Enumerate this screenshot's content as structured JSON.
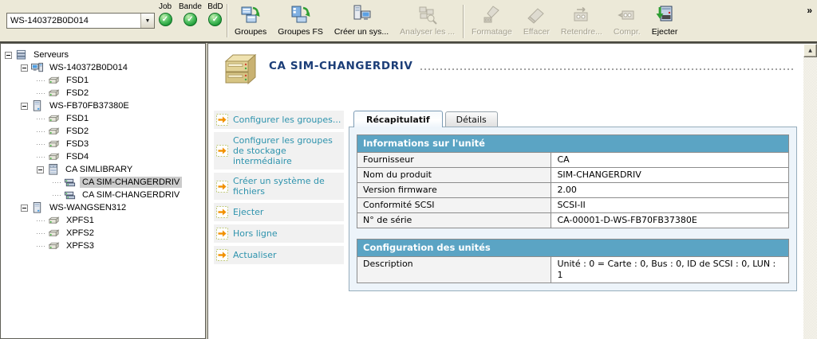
{
  "toolbar": {
    "server_selector": {
      "value": "WS-140372B0D014"
    },
    "status_indicators": [
      {
        "label": "Job",
        "state": "ok"
      },
      {
        "label": "Bande",
        "state": "ok"
      },
      {
        "label": "BdD",
        "state": "ok"
      }
    ],
    "buttons": [
      {
        "label": "Groupes",
        "icon": "groups-icon",
        "enabled": true
      },
      {
        "label": "Groupes FS",
        "icon": "groups-fs-icon",
        "enabled": true
      },
      {
        "label": "Créer un sys...",
        "icon": "create-fs-icon",
        "enabled": true
      },
      {
        "label": "Analyser les ...",
        "icon": "analyze-icon",
        "enabled": false
      },
      {
        "label": "Formatage",
        "icon": "format-icon",
        "enabled": false,
        "group_start": true
      },
      {
        "label": "Effacer",
        "icon": "erase-icon",
        "enabled": false
      },
      {
        "label": "Retendre...",
        "icon": "retension-icon",
        "enabled": false
      },
      {
        "label": "Compr.",
        "icon": "compress-icon",
        "enabled": false
      },
      {
        "label": "Ejecter",
        "icon": "eject-icon",
        "enabled": true
      }
    ],
    "overflow_chevron": "»"
  },
  "tree": {
    "items": [
      {
        "label": "Serveurs",
        "level": 0,
        "icon": "servers-icon",
        "expandable": true
      },
      {
        "label": "WS-140372B0D014",
        "level": 1,
        "icon": "computer-icon",
        "expandable": true
      },
      {
        "label": "FSD1",
        "level": 2,
        "icon": "drive-icon"
      },
      {
        "label": "FSD2",
        "level": 2,
        "icon": "drive-icon"
      },
      {
        "label": "WS-FB70FB37380E",
        "level": 1,
        "icon": "server-icon",
        "expandable": true
      },
      {
        "label": "FSD1",
        "level": 2,
        "icon": "drive-icon"
      },
      {
        "label": "FSD2",
        "level": 2,
        "icon": "drive-icon"
      },
      {
        "label": "FSD3",
        "level": 2,
        "icon": "drive-icon"
      },
      {
        "label": "FSD4",
        "level": 2,
        "icon": "drive-icon"
      },
      {
        "label": "CA SIMLIBRARY",
        "level": 2,
        "icon": "library-icon",
        "expandable": true
      },
      {
        "label": "CA SIM-CHANGERDRIV",
        "level": 3,
        "icon": "changer-icon",
        "selected": true
      },
      {
        "label": "CA SIM-CHANGERDRIV",
        "level": 3,
        "icon": "changer-icon"
      },
      {
        "label": "WS-WANGSEN312",
        "level": 1,
        "icon": "server-icon",
        "expandable": true
      },
      {
        "label": "XPFS1",
        "level": 2,
        "icon": "drive-icon"
      },
      {
        "label": "XPFS2",
        "level": 2,
        "icon": "drive-icon"
      },
      {
        "label": "XPFS3",
        "level": 2,
        "icon": "drive-icon"
      }
    ]
  },
  "main": {
    "title": "CA SIM-CHANGERDRIV",
    "device_icon": "tape-drive-icon",
    "actions": [
      "Configurer les groupes...",
      "Configurer les groupes de stockage intermédiaire",
      "Créer un système de fichiers",
      "Ejecter",
      "Hors ligne",
      "Actualiser"
    ],
    "tabs": [
      {
        "label": "Récapitulatif",
        "active": true
      },
      {
        "label": "Détails",
        "active": false
      }
    ],
    "sections": [
      {
        "header": "Informations sur l'unité",
        "rows": [
          {
            "label": "Fournisseur",
            "value": "CA"
          },
          {
            "label": "Nom du produit",
            "value": "SIM-CHANGERDRIV"
          },
          {
            "label": "Version firmware",
            "value": "2.00"
          },
          {
            "label": "Conformité SCSI",
            "value": "SCSI-II"
          },
          {
            "label": "N° de série",
            "value": "CA-00001-D-WS-FB70FB37380E"
          }
        ]
      },
      {
        "header": "Configuration des unités",
        "rows": [
          {
            "label": "Description",
            "value": "Unité : 0 = Carte : 0, Bus : 0, ID de SCSI : 0, LUN : 1"
          }
        ]
      }
    ]
  },
  "colors": {
    "toolbar_bg": "#ece9d8",
    "status_ok_green": "#2fa83c",
    "selected_tree_bg": "#cbcbcb",
    "title_blue": "#1c3e78",
    "link_teal": "#2e93ad",
    "action_arrow_orange": "#f29100",
    "section_header_bg": "#5ba4c4",
    "container_bg": "#edf4fa",
    "container_border": "#96adbc"
  }
}
